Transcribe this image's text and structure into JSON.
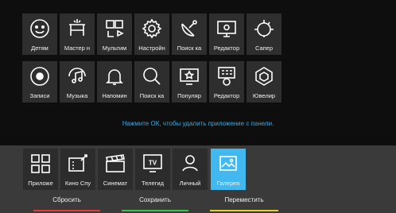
{
  "apps_top": [
    {
      "label": "Детям",
      "icon": "kids-icon"
    },
    {
      "label": "Мастер н",
      "icon": "master-icon"
    },
    {
      "label": "Мультим",
      "icon": "multimedia-icon"
    },
    {
      "label": "Настройн",
      "icon": "settings-gear-icon"
    },
    {
      "label": "Поиск ка",
      "icon": "satellite-search-icon"
    },
    {
      "label": "Редактор",
      "icon": "editor-tv-icon"
    },
    {
      "label": "Сапер",
      "icon": "minesweeper-icon"
    }
  ],
  "apps_middle": [
    {
      "label": "Записи",
      "icon": "record-icon"
    },
    {
      "label": "Музыка",
      "icon": "music-icon"
    },
    {
      "label": "Напомин",
      "icon": "bell-icon"
    },
    {
      "label": "Поиск ка",
      "icon": "search-icon"
    },
    {
      "label": "Популяр",
      "icon": "popular-icon"
    },
    {
      "label": "Редактор",
      "icon": "editor-grid-icon"
    },
    {
      "label": "Ювелир",
      "icon": "jewel-icon"
    }
  ],
  "hint": "Нажмите ОК, чтобы удалить приложение с панели.",
  "panel": [
    {
      "label": "Приложе",
      "icon": "apps-grid-icon"
    },
    {
      "label": "Кино Спу",
      "icon": "cinema-sputnik-icon"
    },
    {
      "label": "Синемат",
      "icon": "clapperboard-icon"
    },
    {
      "label": "Телегид",
      "icon": "tv-guide-icon"
    },
    {
      "label": "Личный",
      "icon": "user-icon"
    },
    {
      "label": "Галерея",
      "icon": "gallery-icon"
    }
  ],
  "selected_panel_index": 5,
  "actions": {
    "reset": {
      "label": "Сбросить",
      "color": "#e03a3a"
    },
    "save": {
      "label": "Сохранить",
      "color": "#3cc24a"
    },
    "move": {
      "label": "Переместить",
      "color": "#e6cf2a"
    }
  },
  "colors": {
    "accent": "#41b8f0",
    "hint": "#3ea6dc"
  }
}
